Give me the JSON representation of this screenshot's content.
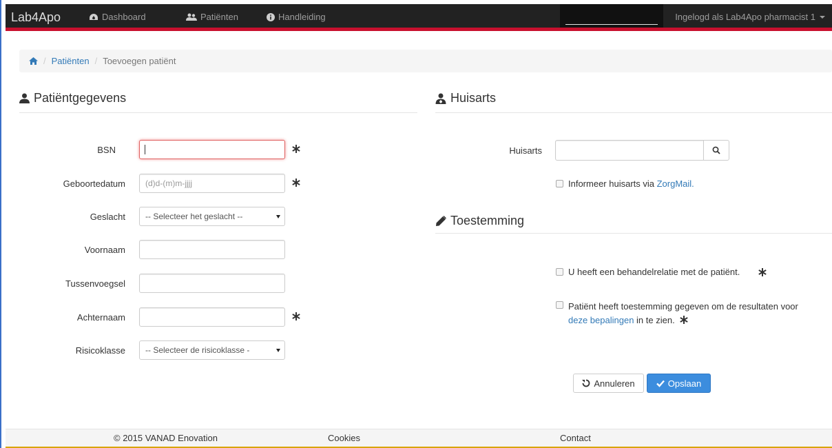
{
  "navbar": {
    "brand": "Lab4Apo",
    "items": [
      {
        "label": "Dashboard"
      },
      {
        "label": "Patiënten"
      },
      {
        "label": "Handleiding"
      }
    ],
    "user": "Ingelogd als Lab4Apo pharmacist 1"
  },
  "breadcrumb": {
    "patients": "Patiënten",
    "separator": "/",
    "current": "Toevoegen patiënt"
  },
  "patient": {
    "title": "Patiëntgegevens",
    "bsn_label": "BSN",
    "bsn_value": "",
    "dob_label": "Geboortedatum",
    "dob_placeholder": "(d)d-(m)m-jjjj",
    "gender_label": "Geslacht",
    "gender_value": "-- Selecteer het geslacht --",
    "firstname_label": "Voornaam",
    "infix_label": "Tussenvoegsel",
    "lastname_label": "Achternaam",
    "risk_label": "Risicoklasse",
    "risk_value": "-- Selecteer de risicoklasse -"
  },
  "gp": {
    "title": "Huisarts",
    "label": "Huisarts",
    "inform_prefix": "Informeer huisarts via ",
    "inform_link": "ZorgMail."
  },
  "consent": {
    "title": "Toestemming",
    "relation": "U heeft een behandelrelatie met de patiënt.",
    "permission_line1": "Patiënt heeft toestemming gegeven om de resultaten voor",
    "permission_link": "deze bepalingen",
    "permission_rest": " in te zien."
  },
  "actions": {
    "cancel": "Annuleren",
    "save": "Opslaan"
  },
  "footer": {
    "copyright": "© 2015 VANAD Enovation",
    "cookies": "Cookies",
    "contact": "Contact"
  },
  "colors": {
    "navbar_bg": "#222222",
    "navbar_accent": "#c8102e",
    "link": "#337ab7",
    "primary": "#3c8dde",
    "required_focus": "#e06060"
  }
}
